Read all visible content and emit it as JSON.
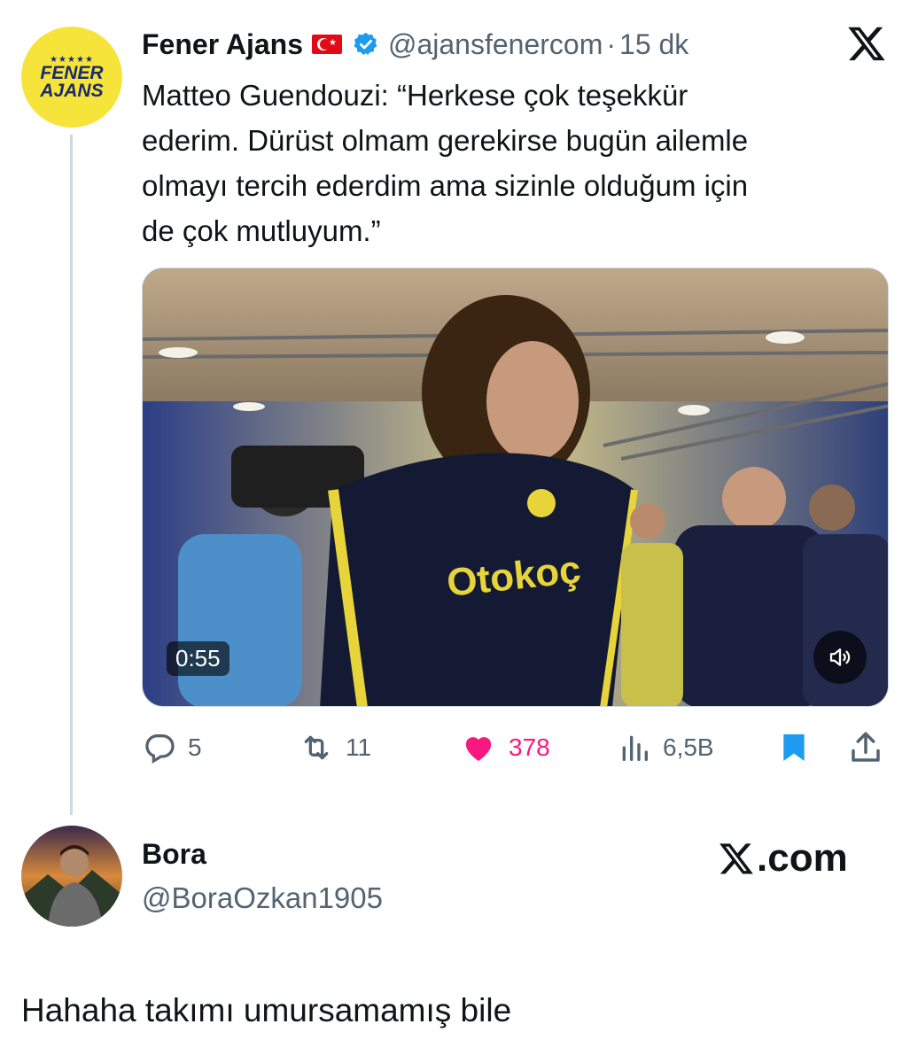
{
  "quoted_tweet": {
    "avatar_logo": "FENER\nAJANS",
    "display_name": "Fener Ajans",
    "flag_icon": "turkey-flag-icon",
    "verified_icon": "verified-badge-icon",
    "handle": "@ajansfenercom",
    "separator": "·",
    "time": "15 dk",
    "text": "Matteo Guendouzi: “Herkese çok teşekkür\nederim. Dürüst olmam gerekirse bugün ailemle\nolmayı tercih ederdim ama sizinle olduğum için\nde çok mutluyum.”",
    "media": {
      "duration": "0:55",
      "sponsor_text": "Otokoç"
    },
    "actions": {
      "replies": "5",
      "reposts": "11",
      "likes": "378",
      "views": "6,5B"
    }
  },
  "author": {
    "name": "Bora",
    "handle": "@BoraOzkan1905"
  },
  "watermark": ".com",
  "reply_text": "Hahaha takımı umursamamış bile",
  "colors": {
    "text": "#0f1419",
    "secondary": "#536471",
    "like": "#f91880",
    "verified": "#1d9bf0",
    "bookmark": "#1d9bf0",
    "fener_yellow": "#f6e43a",
    "fener_navy": "#1b2a6b"
  }
}
